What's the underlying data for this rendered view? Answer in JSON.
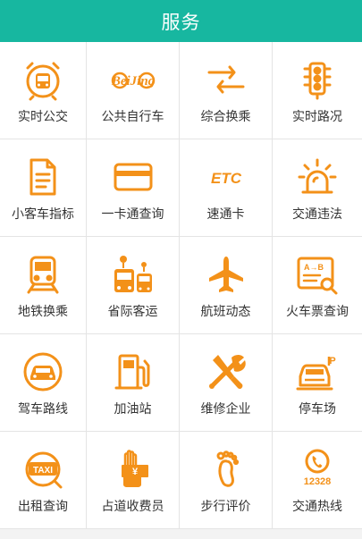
{
  "header": {
    "title": "服务"
  },
  "services": [
    {
      "label": "实时公交",
      "icon": "bus-alarm-icon"
    },
    {
      "label": "公共自行车",
      "icon": "beijing-bike-logo-icon",
      "logo_text": "BeiJing"
    },
    {
      "label": "综合换乘",
      "icon": "transfer-arrows-icon"
    },
    {
      "label": "实时路况",
      "icon": "traffic-light-icon"
    },
    {
      "label": "小客车指标",
      "icon": "document-icon"
    },
    {
      "label": "一卡通查询",
      "icon": "card-icon"
    },
    {
      "label": "速通卡",
      "icon": "etc-icon",
      "logo_text": "ETC"
    },
    {
      "label": "交通违法",
      "icon": "warning-light-icon"
    },
    {
      "label": "地铁换乘",
      "icon": "subway-icon"
    },
    {
      "label": "省际客运",
      "icon": "coach-icon"
    },
    {
      "label": "航班动态",
      "icon": "airplane-icon"
    },
    {
      "label": "火车票查询",
      "icon": "train-ticket-icon",
      "logo_text": "A→B"
    },
    {
      "label": "驾车路线",
      "icon": "car-route-icon"
    },
    {
      "label": "加油站",
      "icon": "gas-station-icon"
    },
    {
      "label": "维修企业",
      "icon": "repair-tools-icon"
    },
    {
      "label": "停车场",
      "icon": "parking-icon",
      "logo_text": "P"
    },
    {
      "label": "出租查询",
      "icon": "taxi-icon",
      "logo_text": "TAXI"
    },
    {
      "label": "占道收费员",
      "icon": "toll-collector-icon",
      "logo_text": "¥"
    },
    {
      "label": "步行评价",
      "icon": "footprint-icon"
    },
    {
      "label": "交通热线",
      "icon": "hotline-icon",
      "logo_text": "12328"
    }
  ],
  "colors": {
    "header": "#17b7a0",
    "accent": "#f39119",
    "text": "#333333",
    "divider": "#e4e4e4"
  }
}
